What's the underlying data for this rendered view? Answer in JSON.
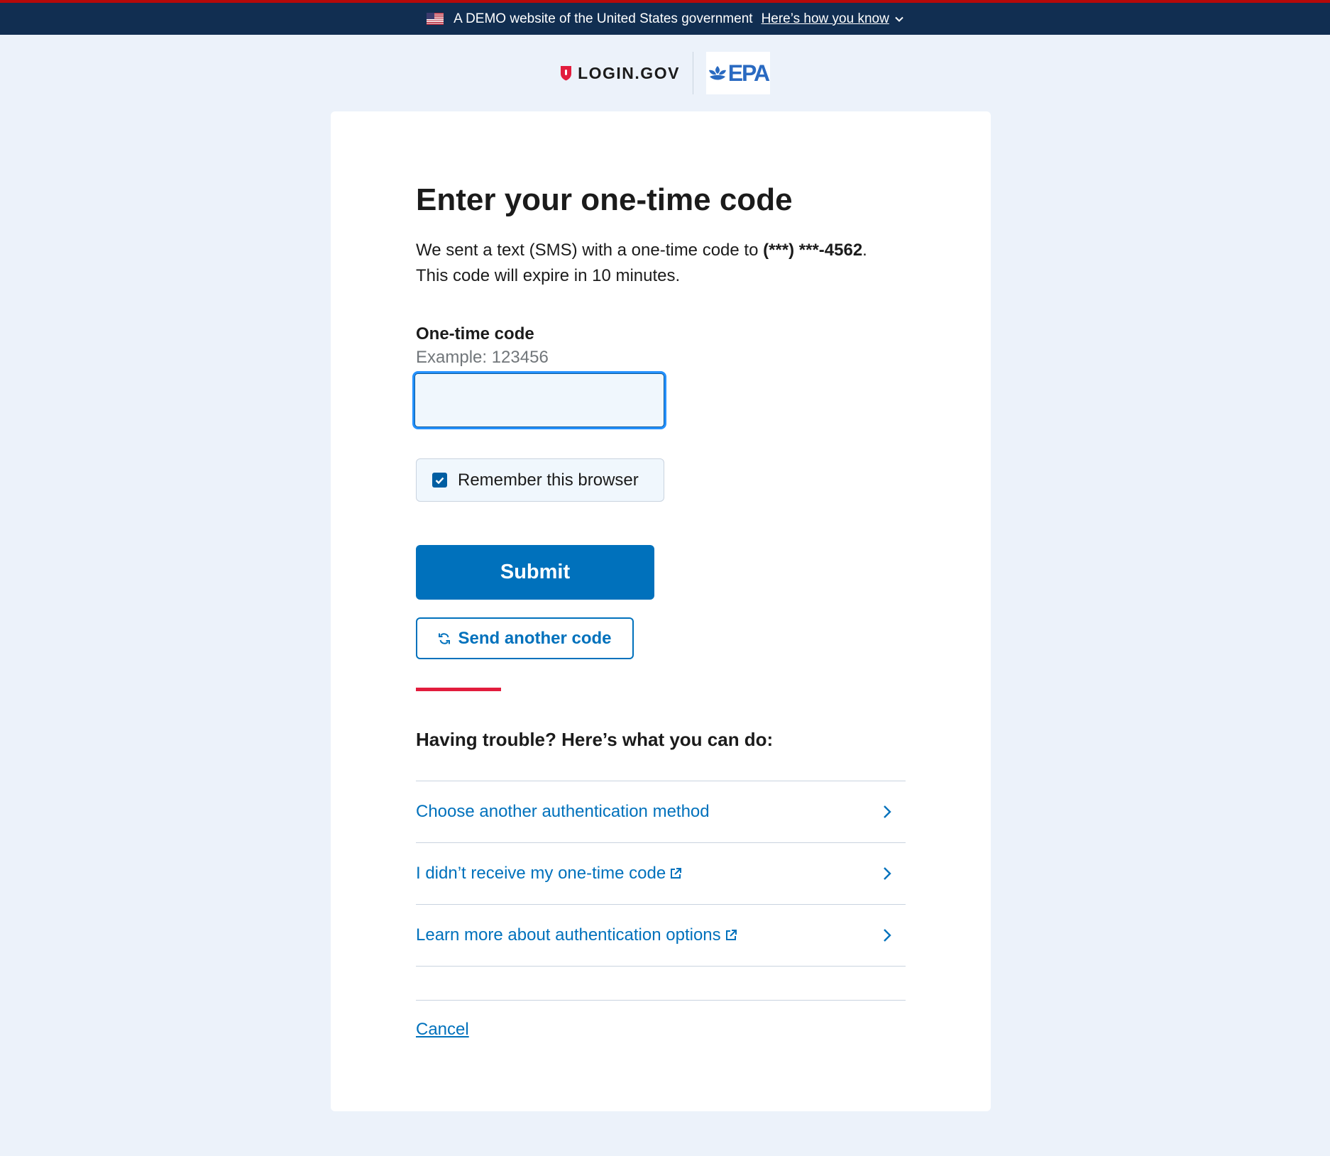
{
  "banner": {
    "text": "A DEMO website of the United States government",
    "link": "Here’s how you know",
    "colors": {
      "background": "#112e51",
      "top_stripe": "#b50909"
    }
  },
  "header": {
    "logingov_text": "LOGIN.GOV",
    "partner_logo_text": "EPA"
  },
  "page": {
    "title": "Enter your one-time code",
    "intro_prefix": "We sent a text (SMS) with a one-time code to ",
    "phone_masked": "(***) ***-4562",
    "intro_suffix": ".",
    "expiry_text": "This code will expire in 10 minutes."
  },
  "form": {
    "code_label": "One-time code",
    "code_hint": "Example: 123456",
    "code_value": "",
    "remember_label": "Remember this browser",
    "remember_checked": true,
    "submit_label": "Submit",
    "resend_label": "Send another code"
  },
  "trouble": {
    "heading": "Having trouble? Here’s what you can do:",
    "items": [
      {
        "label": "Choose another authentication method",
        "external": false
      },
      {
        "label": "I didn’t receive my one-time code",
        "external": true
      },
      {
        "label": "Learn more about authentication options",
        "external": true
      }
    ]
  },
  "footer": {
    "cancel_label": "Cancel"
  },
  "icons": {
    "flag": "us-flag-icon",
    "banner_chevron": "chevron-down-icon",
    "logingov_shield": "shield-icon",
    "epa_flower": "epa-flower-icon",
    "checkbox": "checkmark-icon",
    "resend": "refresh-icon",
    "row_chevron": "chevron-right-icon",
    "external": "external-link-icon"
  },
  "colors": {
    "page_bg": "#ecf2fa",
    "primary": "#0071bc",
    "accent_rule": "#e21c3d",
    "text": "#1b1b1b",
    "hint": "#71767a"
  }
}
